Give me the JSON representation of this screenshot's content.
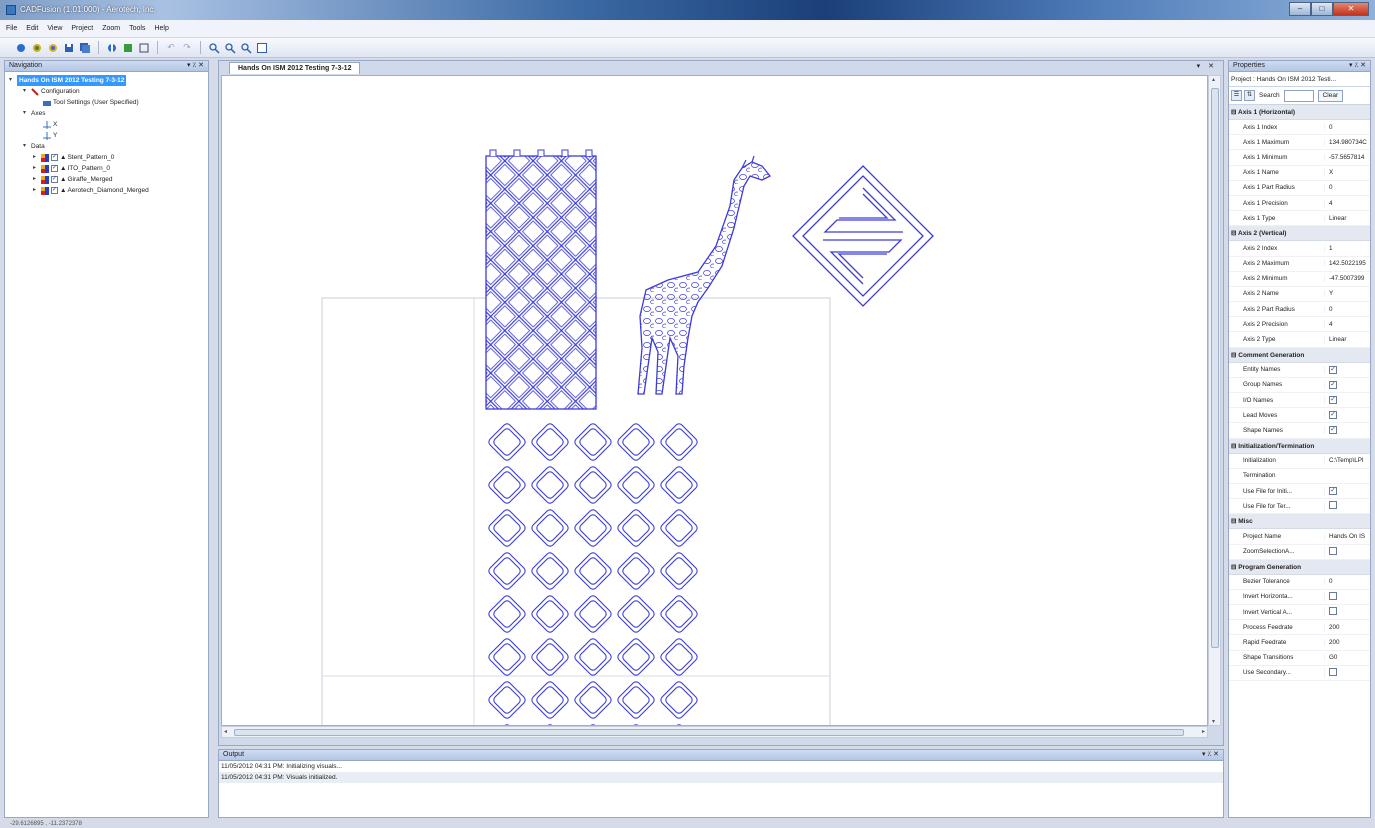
{
  "window": {
    "title": "CADFusion (1.01.000) - Aerotech, Inc."
  },
  "menu": [
    "File",
    "Edit",
    "View",
    "Project",
    "Zoom",
    "Tools",
    "Help"
  ],
  "toolbar": {
    "icons": [
      "new-project-icon",
      "open-icon",
      "open-folder-icon",
      "save-icon",
      "save-all-icon",
      "import-icon",
      "export-icon",
      "preview-icon",
      "undo-icon",
      "redo-icon",
      "zoom-in-icon",
      "zoom-out-icon",
      "zoom-window-icon",
      "zoom-extents-icon"
    ]
  },
  "navigation": {
    "header": "Navigation",
    "project": "Hands On ISM 2012 Testing 7-3-12",
    "configuration": "Configuration",
    "tool_settings": "Tool Settings (User Specified)",
    "axes_label": "Axes",
    "axes": [
      "X",
      "Y"
    ],
    "data_label": "Data",
    "data": [
      "Stent_Pattern_0",
      "ITO_Pattern_0",
      "Giraffe_Merged",
      "Aerotech_Diamond_Merged"
    ]
  },
  "document": {
    "tab": "Hands On ISM 2012 Testing 7-3-12"
  },
  "output": {
    "header": "Output",
    "lines": [
      "11/05/2012 04:31 PM: Initializing visuals...",
      "11/05/2012 04:31 PM: Visuals initialized."
    ]
  },
  "properties": {
    "header": "Properties",
    "object": "Project : Hands On ISM 2012 Testi...",
    "search_label": "Search",
    "clear": "Clear",
    "categories": [
      {
        "name": "Axis 1 (Horizontal)",
        "rows": [
          {
            "name": "Axis 1 Index",
            "value": "0"
          },
          {
            "name": "Axis 1 Maximum",
            "value": "134.980734C"
          },
          {
            "name": "Axis 1 Minimum",
            "value": "-57.5657814"
          },
          {
            "name": "Axis 1 Name",
            "value": "X"
          },
          {
            "name": "Axis 1 Part Radius",
            "value": "0"
          },
          {
            "name": "Axis 1 Precision",
            "value": "4"
          },
          {
            "name": "Axis 1 Type",
            "value": "Linear"
          }
        ]
      },
      {
        "name": "Axis 2 (Vertical)",
        "rows": [
          {
            "name": "Axis 2 Index",
            "value": "1"
          },
          {
            "name": "Axis 2 Maximum",
            "value": "142.5022195"
          },
          {
            "name": "Axis 2 Minimum",
            "value": "-47.5007399"
          },
          {
            "name": "Axis 2 Name",
            "value": "Y"
          },
          {
            "name": "Axis 2 Part Radius",
            "value": "0"
          },
          {
            "name": "Axis 2 Precision",
            "value": "4"
          },
          {
            "name": "Axis 2 Type",
            "value": "Linear"
          }
        ]
      },
      {
        "name": "Comment Generation",
        "rows": [
          {
            "name": "Entity Names",
            "check": true
          },
          {
            "name": "Group Names",
            "check": true
          },
          {
            "name": "I/O Names",
            "check": true
          },
          {
            "name": "Lead Moves",
            "check": true
          },
          {
            "name": "Shape Names",
            "check": true
          }
        ]
      },
      {
        "name": "Initialization/Termination",
        "rows": [
          {
            "name": "Initialization",
            "value": "C:\\Temp\\LPI"
          },
          {
            "name": "Termination",
            "value": ""
          },
          {
            "name": "Use File for Initi...",
            "check": true
          },
          {
            "name": "Use File for Ter...",
            "check": false
          }
        ]
      },
      {
        "name": "Misc",
        "rows": [
          {
            "name": "Project Name",
            "value": "Hands On IS"
          },
          {
            "name": "ZoomSelectionA...",
            "check": false
          }
        ]
      },
      {
        "name": "Program Generation",
        "rows": [
          {
            "name": "Bezier Tolerance",
            "value": "0"
          },
          {
            "name": "Invert Horizonta...",
            "check": false
          },
          {
            "name": "Invert Vertical A...",
            "check": false
          },
          {
            "name": "Process Feedrate",
            "value": "200"
          },
          {
            "name": "Rapid Feedrate",
            "value": "200"
          },
          {
            "name": "Shape Transitions",
            "value": "G0"
          },
          {
            "name": "Use Secondary...",
            "check": false
          }
        ]
      }
    ]
  },
  "status": {
    "coords": "-29.6126895 , -11.2372378"
  },
  "colors": {
    "pattern": "#3b3bdc",
    "selection": "#3399ff"
  }
}
